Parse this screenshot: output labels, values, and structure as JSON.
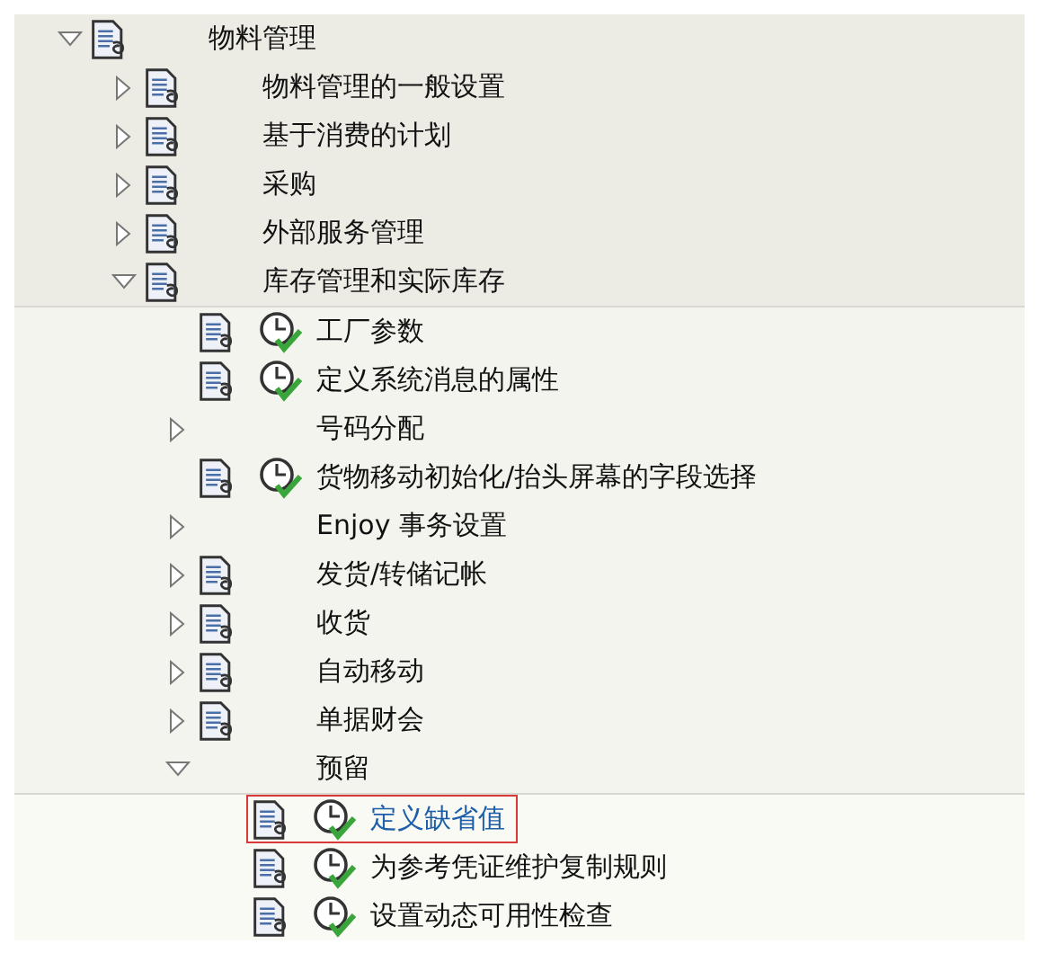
{
  "tree": [
    {
      "label": "物料管理",
      "kind": "folder",
      "expanded": true,
      "document": true,
      "selected": false,
      "children": [
        {
          "label": "物料管理的一般设置",
          "kind": "folder",
          "expanded": false,
          "document": true,
          "selected": false
        },
        {
          "label": "基于消费的计划",
          "kind": "folder",
          "expanded": false,
          "document": true,
          "selected": false
        },
        {
          "label": "采购",
          "kind": "folder",
          "expanded": false,
          "document": true,
          "selected": false
        },
        {
          "label": "外部服务管理",
          "kind": "folder",
          "expanded": false,
          "document": true,
          "selected": false
        },
        {
          "label": "库存管理和实际库存",
          "kind": "folder",
          "expanded": true,
          "document": true,
          "selected": false,
          "children": [
            {
              "label": "工厂参数",
              "kind": "activity",
              "document": true,
              "selected": false
            },
            {
              "label": "定义系统消息的属性",
              "kind": "activity",
              "document": true,
              "selected": false
            },
            {
              "label": "号码分配",
              "kind": "folder",
              "expanded": false,
              "document": false,
              "selected": false
            },
            {
              "label": "货物移动初始化/抬头屏幕的字段选择",
              "kind": "activity",
              "document": true,
              "selected": false
            },
            {
              "label": "Enjoy 事务设置",
              "kind": "folder",
              "expanded": false,
              "document": false,
              "selected": false
            },
            {
              "label": "发货/转储记帐",
              "kind": "folder",
              "expanded": false,
              "document": true,
              "selected": false
            },
            {
              "label": "收货",
              "kind": "folder",
              "expanded": false,
              "document": true,
              "selected": false
            },
            {
              "label": "自动移动",
              "kind": "folder",
              "expanded": false,
              "document": true,
              "selected": false
            },
            {
              "label": "单据财会",
              "kind": "folder",
              "expanded": false,
              "document": true,
              "selected": false
            },
            {
              "label": "预留",
              "kind": "folder",
              "expanded": true,
              "document": false,
              "selected": false,
              "children": [
                {
                  "label": "定义缺省值",
                  "kind": "activity",
                  "document": true,
                  "selected": true
                },
                {
                  "label": "为参考凭证维护复制规则",
                  "kind": "activity",
                  "document": true,
                  "selected": false
                },
                {
                  "label": "设置动态可用性检查",
                  "kind": "activity",
                  "document": true,
                  "selected": false
                }
              ]
            }
          ]
        }
      ]
    }
  ]
}
